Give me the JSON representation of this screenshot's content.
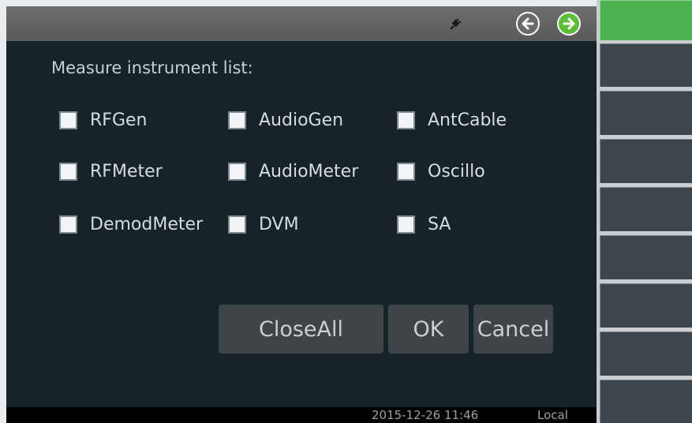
{
  "titlebar": {
    "icons": [
      "plug-icon",
      "back-arrow-icon",
      "forward-arrow-icon"
    ],
    "forward_color": "#5bbd38"
  },
  "dialog": {
    "title": "Measure instrument list:",
    "instruments": [
      {
        "label": "RFGen",
        "checked": false
      },
      {
        "label": "AudioGen",
        "checked": false
      },
      {
        "label": "AntCable",
        "checked": false
      },
      {
        "label": "RFMeter",
        "checked": false
      },
      {
        "label": "AudioMeter",
        "checked": false
      },
      {
        "label": "Oscillo",
        "checked": false
      },
      {
        "label": "DemodMeter",
        "checked": false
      },
      {
        "label": "DVM",
        "checked": false
      },
      {
        "label": "SA",
        "checked": false
      }
    ],
    "buttons": {
      "close_all": "CloseAll",
      "ok": "OK",
      "cancel": "Cancel"
    }
  },
  "statusbar": {
    "datetime": "2015-12-26 11:46",
    "mode": "Local"
  },
  "softkeys": {
    "count": 9,
    "active_color": "#4db14f",
    "labels": [
      "",
      "",
      "",
      "",
      "",
      "",
      "",
      "",
      ""
    ]
  }
}
